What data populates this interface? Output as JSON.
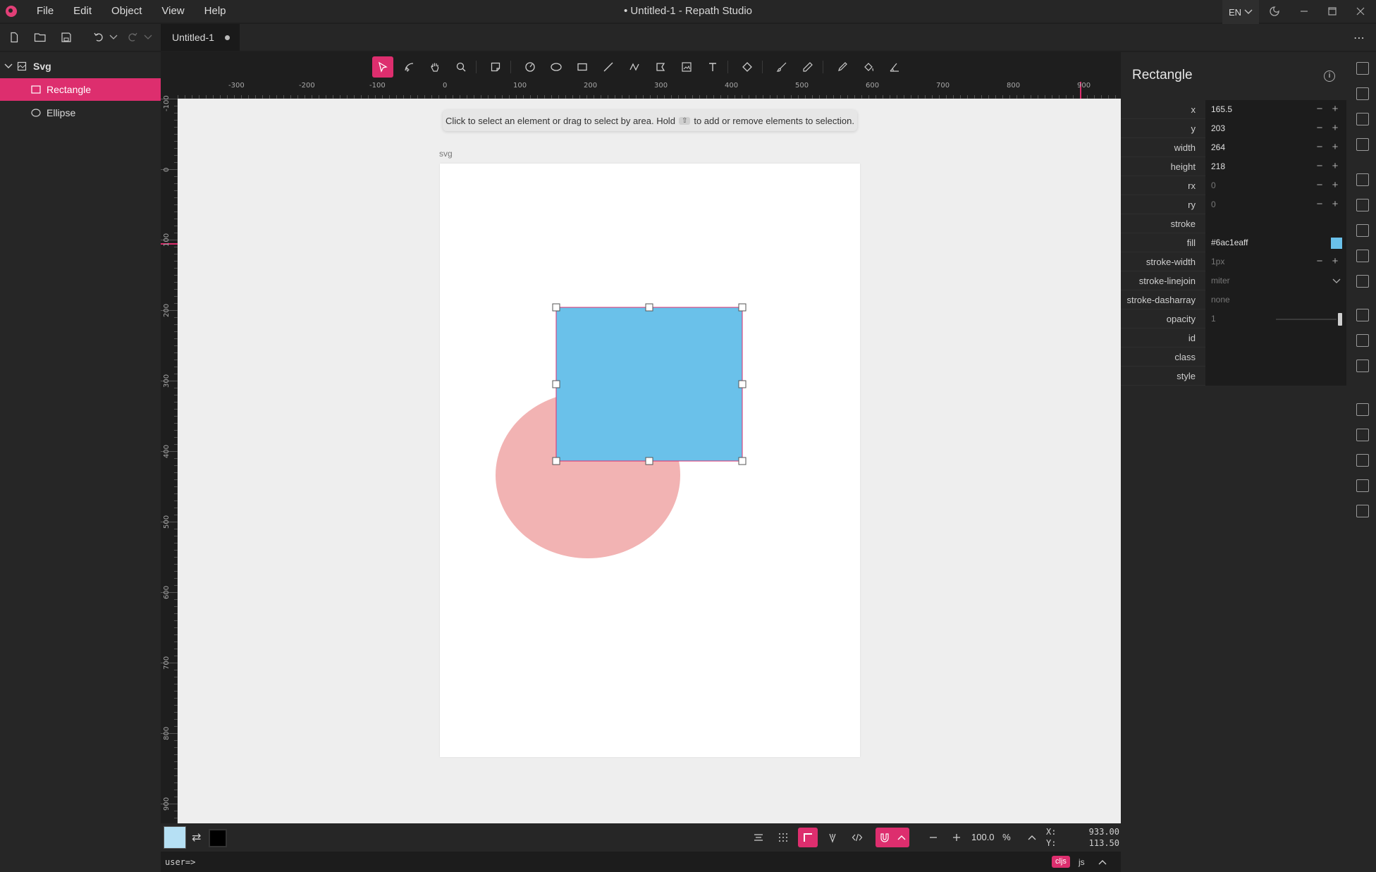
{
  "app": {
    "window_title": "• Untitled-1 - Repath Studio",
    "menu": [
      "File",
      "Edit",
      "Object",
      "View",
      "Help"
    ],
    "language": "EN",
    "tab_title": "Untitled-1"
  },
  "layers": {
    "root": "Svg",
    "items": [
      {
        "label": "Rectangle",
        "selected": true
      },
      {
        "label": "Ellipse",
        "selected": false
      }
    ]
  },
  "canvas": {
    "hint_before": "Click to select an element or drag to select by area. Hold",
    "hint_key": "⇧",
    "hint_after": "to add or remove elements to selection.",
    "artboard_label": "svg",
    "ruler_top_ticks": [
      "-300",
      "-200",
      "-100",
      "0",
      "100",
      "200",
      "300",
      "400",
      "500",
      "600",
      "700",
      "800",
      "900"
    ],
    "ruler_left_ticks": [
      "-100",
      "0",
      "100",
      "200",
      "300",
      "400",
      "500",
      "600",
      "700",
      "800",
      "900"
    ]
  },
  "shapes": {
    "rect_fill": "#6ac1ea",
    "ellipse_fill": "#f2b3b3",
    "selection_color": "#dd2e6e"
  },
  "properties": {
    "title": "Rectangle",
    "rows": [
      {
        "label": "x",
        "value": "165.5",
        "muted": false,
        "stepper": true
      },
      {
        "label": "y",
        "value": "203",
        "muted": false,
        "stepper": true
      },
      {
        "label": "width",
        "value": "264",
        "muted": false,
        "stepper": true
      },
      {
        "label": "height",
        "value": "218",
        "muted": false,
        "stepper": true
      },
      {
        "label": "rx",
        "value": "0",
        "muted": true,
        "stepper": true
      },
      {
        "label": "ry",
        "value": "0",
        "muted": true,
        "stepper": true
      },
      {
        "label": "stroke",
        "value": "",
        "muted": false,
        "stepper": false
      },
      {
        "label": "fill",
        "value": "#6ac1eaff",
        "muted": false,
        "stepper": false,
        "swatch": "#6ac1ea"
      },
      {
        "label": "stroke-width",
        "value": "1px",
        "muted": true,
        "stepper": true
      },
      {
        "label": "stroke-linejoin",
        "value": "miter",
        "muted": true,
        "stepper": false,
        "dropdown": true
      },
      {
        "label": "stroke-dasharray",
        "value": "none",
        "muted": true,
        "stepper": false
      },
      {
        "label": "opacity",
        "value": "1",
        "muted": true,
        "stepper": false,
        "slider": true
      },
      {
        "label": "id",
        "value": "",
        "muted": false,
        "stepper": false
      },
      {
        "label": "class",
        "value": "",
        "muted": false,
        "stepper": false
      },
      {
        "label": "style",
        "value": "",
        "muted": false,
        "stepper": false
      }
    ]
  },
  "status": {
    "zoom": "100.0",
    "zoom_unit": "%",
    "x_label": "X:",
    "x_value": "933.00",
    "y_label": "Y:",
    "y_value": "113.50",
    "fill_color": "#b6e0f4",
    "stroke_color": "#000000"
  },
  "repl": {
    "prompt": "user=>",
    "lang_active": "cljs",
    "lang_other": "js"
  }
}
